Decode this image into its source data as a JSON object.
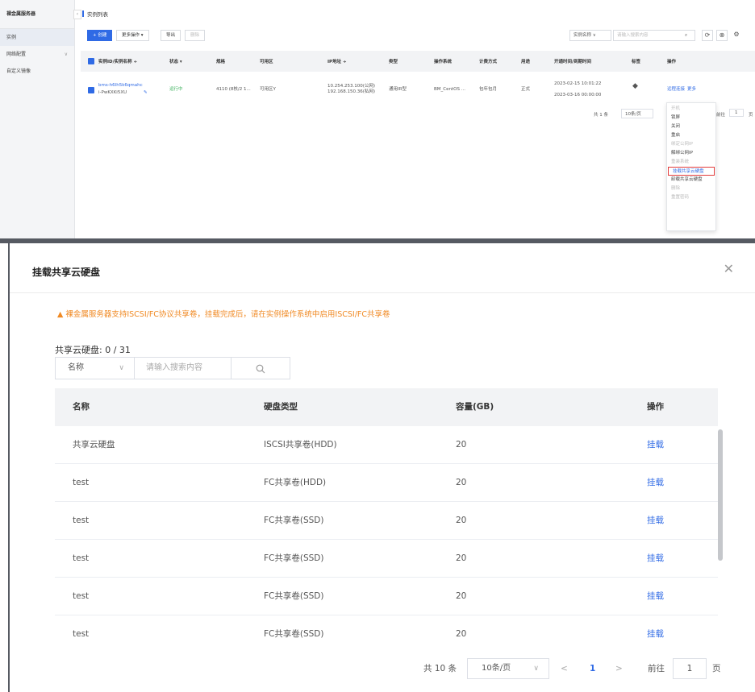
{
  "top": {
    "sidebar": {
      "title": "裸金属服务器",
      "items": [
        {
          "label": "实例"
        },
        {
          "label": "网络配置",
          "chevron": "chevron-down-icon"
        },
        {
          "label": "自定义镜像"
        }
      ]
    },
    "breadcrumb": "实例列表",
    "toolbar": {
      "create_label": "+ 创建",
      "more_label": "更多操作 ▾",
      "export_label": "导出",
      "delete_label": "删除",
      "filter_select": "实例名称  ∨",
      "search_placeholder": "请输入搜索内容"
    },
    "table": {
      "headers": [
        "实例ID/实例名称 ÷",
        "状态 ▾",
        "规格",
        "可用区",
        "IP地址 ÷",
        "类型",
        "操作系统",
        "计费方式",
        "用途",
        "开通时间/到期时间",
        "标签",
        "操作"
      ],
      "row": {
        "id": "bms-h6lh5k6qmahc",
        "name": "i-PwKXKi5XU",
        "status": "运行中",
        "spec": "4110 (8核/2 1...",
        "zone": "可用区Y",
        "ip1": "10.254.253.100(公网)",
        "ip2": "192.168.150.36(私网)",
        "type": "通用IR型",
        "os": "BM_CentOS ...",
        "billing": "包年包月",
        "usage": "正式",
        "open_time": "2023-02-15 10:01:22",
        "expire_time": "2023-03-16 00:00:00",
        "tag_icon": "tag-icon",
        "op_remote": "远程连接",
        "op_more": "更多"
      }
    },
    "mini_pager": {
      "total": "共 1 条",
      "size": "10条/页",
      "goto": "前往",
      "page": "1",
      "page_unit": "页"
    },
    "more_menu": [
      {
        "label": "开机",
        "disabled": true
      },
      {
        "label": "锁屏",
        "disabled": false
      },
      {
        "label": "关闭",
        "disabled": false
      },
      {
        "label": "重启",
        "disabled": false
      },
      {
        "label": "绑定公网IP",
        "disabled": true
      },
      {
        "label": "解绑公网IP",
        "disabled": false
      },
      {
        "label": "重装系统",
        "disabled": true
      },
      {
        "label": "挂载共享云硬盘",
        "disabled": false,
        "highlight": true
      },
      {
        "label": "卸载共享云硬盘",
        "disabled": false
      },
      {
        "label": "删除",
        "disabled": true
      },
      {
        "label": "重置密码",
        "disabled": true
      }
    ]
  },
  "dialog": {
    "title": "挂载共享云硬盘",
    "warning": "▲ 裸金属服务器支持ISCSI/FC协议共享卷，挂载完成后，请在实例操作系统中启用ISCSI/FC共享卷",
    "disk_count_label": "共享云硬盘:  0 / 31",
    "search": {
      "field": "名称",
      "placeholder": "请输入搜索内容"
    },
    "table": {
      "headers": [
        "名称",
        "硬盘类型",
        "容量(GB)",
        "操作"
      ],
      "rows": [
        {
          "name": "共享云硬盘",
          "type": "ISCSI共享卷(HDD)",
          "capacity": "20",
          "action": "挂载"
        },
        {
          "name": "test",
          "type": "FC共享卷(HDD)",
          "capacity": "20",
          "action": "挂载"
        },
        {
          "name": "test",
          "type": "FC共享卷(SSD)",
          "capacity": "20",
          "action": "挂载"
        },
        {
          "name": "test",
          "type": "FC共享卷(SSD)",
          "capacity": "20",
          "action": "挂载"
        },
        {
          "name": "test",
          "type": "FC共享卷(SSD)",
          "capacity": "20",
          "action": "挂载"
        },
        {
          "name": "test",
          "type": "FC共享卷(SSD)",
          "capacity": "20",
          "action": "挂载"
        }
      ]
    },
    "pager": {
      "total": "共 10 条",
      "size": "10条/页",
      "prev": "<",
      "current": "1",
      "next": ">",
      "goto": "前往",
      "page": "1",
      "page_unit": "页"
    }
  },
  "colors": {
    "accent": "#2f6ae5",
    "warning": "#f08a24",
    "running": "#3bb15b",
    "highlight_border": "#e23b3b"
  }
}
